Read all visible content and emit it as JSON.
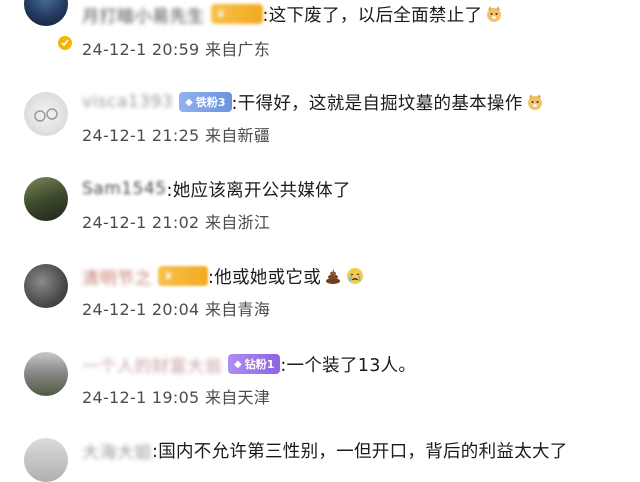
{
  "comments": [
    {
      "username": "月打暗小易先生",
      "badge": "",
      "text": ":这下废了，以后全面禁止了",
      "emoji": "doge-emoji",
      "date": "24-12-1 20:59",
      "location": "来自广东"
    },
    {
      "username": "visca1393",
      "badge": "铁粉3",
      "text": ":干得好，这就是自掘坟墓的基本操作",
      "emoji": "doge-emoji",
      "date": "24-12-1 21:25",
      "location": "来自新疆"
    },
    {
      "username": "Sam1545",
      "badge": "",
      "text": "她应该离开公共媒体了",
      "date": "24-12-1 21:02",
      "location": "来自浙江"
    },
    {
      "username": "清明节之",
      "badge": "",
      "text": ":他或她或它或",
      "emoji": "poop-emoji",
      "emoji2": "crying-face-emoji",
      "date": "24-12-1 20:04",
      "location": "来自青海"
    },
    {
      "username": "一个人的财富大翁",
      "badge": "钻粉1",
      "text": ":一个装了13人。",
      "date": "24-12-1 19:05",
      "location": "来自天津"
    },
    {
      "username": "大海大姐",
      "badge": "",
      "text": ":国内不允许第三性别，一但开口，背后的利益太大了",
      "date": "",
      "location": ""
    }
  ],
  "colors": {
    "text": "#1a1a1a",
    "meta": "#4c4c4c",
    "badge_gold": "#f3a91f",
    "badge_blue": "#6d93e0",
    "badge_purple": "#8d63e3",
    "verified": "#f5b400"
  }
}
